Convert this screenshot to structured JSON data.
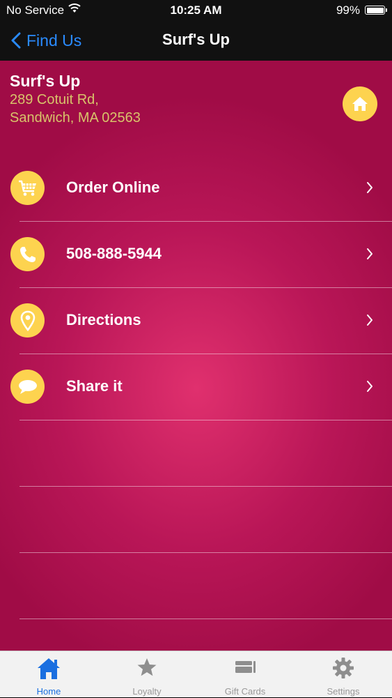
{
  "status_bar": {
    "carrier": "No Service",
    "time": "10:25 AM",
    "battery": "99%"
  },
  "nav": {
    "back_label": "Find Us",
    "title": "Surf's Up"
  },
  "location": {
    "name": "Surf's Up",
    "address_line1": "289 Cotuit Rd,",
    "address_line2": "Sandwich, MA 02563"
  },
  "menu": [
    {
      "label": "Order Online",
      "icon": "cart-icon"
    },
    {
      "label": "508-888-5944",
      "icon": "phone-icon"
    },
    {
      "label": "Directions",
      "icon": "map-pin-icon"
    },
    {
      "label": "Share it",
      "icon": "speech-bubble-icon"
    }
  ],
  "tabs": [
    {
      "label": "Home",
      "icon": "home-icon",
      "active": true
    },
    {
      "label": "Loyalty",
      "icon": "star-icon",
      "active": false
    },
    {
      "label": "Gift Cards",
      "icon": "gift-cards-icon",
      "active": false
    },
    {
      "label": "Settings",
      "icon": "gear-icon",
      "active": false
    }
  ],
  "colors": {
    "accent_blue": "#1a6fe0",
    "icon_yellow": "#fdd34f",
    "background_magenta": "#b91657",
    "address_gold": "#d8c36a"
  }
}
